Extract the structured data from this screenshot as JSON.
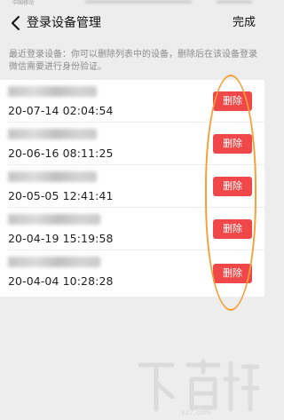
{
  "status_bar": {
    "carrier": "中国移动"
  },
  "navbar": {
    "title": "登录设备管理",
    "done_label": "完成"
  },
  "description": "最近登录设备：你可以删除列表中的设备，删除后在该设备登录微信需要进行身份验证。",
  "devices": [
    {
      "time": "20-07-14 02:04:54",
      "delete_label": "删除"
    },
    {
      "time": "20-06-16 08:11:25",
      "delete_label": "删除"
    },
    {
      "time": "20-05-05 12:41:41",
      "delete_label": "删除"
    },
    {
      "time": "20-04-19 15:19:58",
      "delete_label": "删除"
    },
    {
      "time": "20-04-04 10:28:28",
      "delete_label": "删除"
    }
  ],
  "colors": {
    "background": "#ededed",
    "delete_button": "#f04849",
    "annotation_circle": "#f4a13a"
  },
  "icons": [
    "back-arrow-icon"
  ]
}
